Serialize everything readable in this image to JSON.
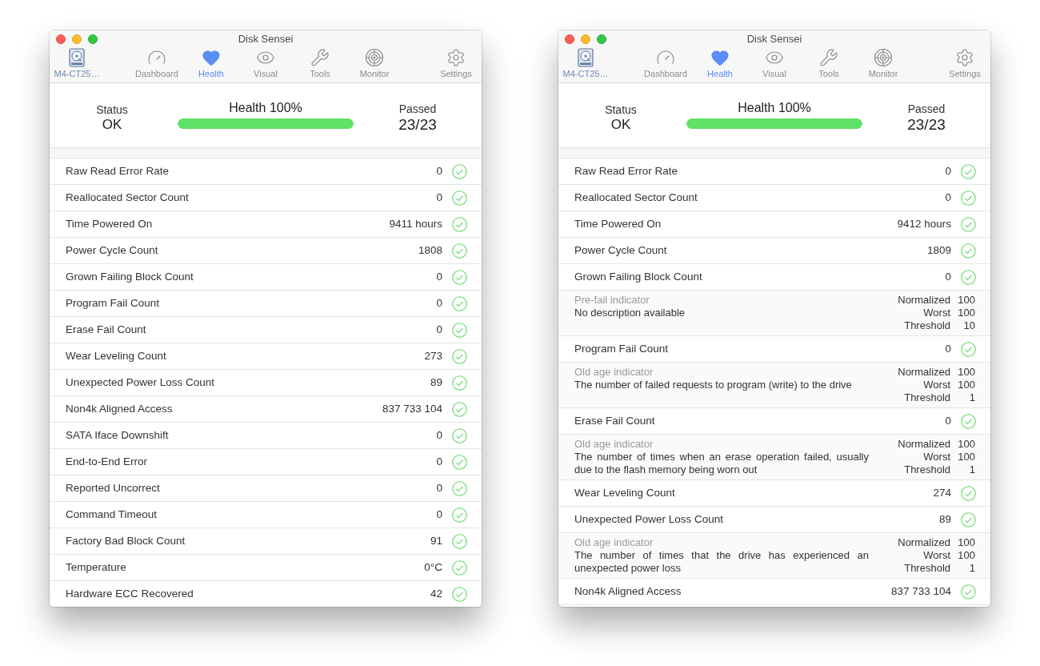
{
  "windows": [
    {
      "title": "Disk Sensei",
      "drive": {
        "label": "M4-CT25…"
      },
      "tabs": [
        {
          "label": "Dashboard",
          "selected": false
        },
        {
          "label": "Health",
          "selected": true
        },
        {
          "label": "Visual",
          "selected": false
        },
        {
          "label": "Tools",
          "selected": false
        },
        {
          "label": "Monitor",
          "selected": false
        }
      ],
      "settings": {
        "label": "Settings"
      },
      "summary": {
        "status_label": "Status",
        "status": "OK",
        "health_label": "Health 100%",
        "health_bar": {
          "level": 1
        },
        "passed_label": "Passed",
        "passed": "23/23"
      },
      "rows": [
        {
          "kind": "attribute",
          "name": "Raw Read Error Rate",
          "value": "0",
          "passed": true
        },
        {
          "kind": "attribute",
          "name": "Reallocated Sector Count",
          "value": "0",
          "passed": true
        },
        {
          "kind": "attribute",
          "name": "Time Powered On",
          "value": "9411 hours",
          "passed": true
        },
        {
          "kind": "attribute",
          "name": "Power Cycle Count",
          "value": "1808",
          "passed": true
        },
        {
          "kind": "attribute",
          "name": "Grown Failing Block Count",
          "value": "0",
          "passed": true
        },
        {
          "kind": "attribute",
          "name": "Program Fail Count",
          "value": "0",
          "passed": true
        },
        {
          "kind": "attribute",
          "name": "Erase Fail Count",
          "value": "0",
          "passed": true
        },
        {
          "kind": "attribute",
          "name": "Wear Leveling Count",
          "value": "273",
          "passed": true
        },
        {
          "kind": "attribute",
          "name": "Unexpected Power Loss Count",
          "value": "89",
          "passed": true
        },
        {
          "kind": "attribute",
          "name": "Non4k Aligned Access",
          "value": "837 733 104",
          "passed": true
        },
        {
          "kind": "attribute",
          "name": "SATA Iface Downshift",
          "value": "0",
          "passed": true
        },
        {
          "kind": "attribute",
          "name": "End-to-End Error",
          "value": "0",
          "passed": true
        },
        {
          "kind": "attribute",
          "name": "Reported Uncorrect",
          "value": "0",
          "passed": true
        },
        {
          "kind": "attribute",
          "name": "Command Timeout",
          "value": "0",
          "passed": true
        },
        {
          "kind": "attribute",
          "name": "Factory Bad Block Count",
          "value": "91",
          "passed": true
        },
        {
          "kind": "attribute",
          "name": "Temperature",
          "value": "0°C",
          "passed": true
        },
        {
          "kind": "attribute",
          "name": "Hardware ECC Recovered",
          "value": "42",
          "passed": true
        }
      ]
    },
    {
      "title": "Disk Sensei",
      "drive": {
        "label": "M4-CT25…"
      },
      "tabs": [
        {
          "label": "Dashboard",
          "selected": false
        },
        {
          "label": "Health",
          "selected": true
        },
        {
          "label": "Visual",
          "selected": false
        },
        {
          "label": "Tools",
          "selected": false
        },
        {
          "label": "Monitor",
          "selected": false
        }
      ],
      "settings": {
        "label": "Settings"
      },
      "summary": {
        "status_label": "Status",
        "status": "OK",
        "health_label": "Health 100%",
        "health_bar": {
          "level": 1
        },
        "passed_label": "Passed",
        "passed": "23/23"
      },
      "rows": [
        {
          "kind": "attribute",
          "name": "Raw Read Error Rate",
          "value": "0",
          "passed": true
        },
        {
          "kind": "attribute",
          "name": "Reallocated Sector Count",
          "value": "0",
          "passed": true
        },
        {
          "kind": "attribute",
          "name": "Time Powered On",
          "value": "9412 hours",
          "passed": true
        },
        {
          "kind": "attribute",
          "name": "Power Cycle Count",
          "value": "1809",
          "passed": true
        },
        {
          "kind": "attribute",
          "name": "Grown Failing Block Count",
          "value": "0",
          "passed": true
        },
        {
          "kind": "detail",
          "indicator": "Pre-fail indicator",
          "description": "No description available",
          "stats": [
            {
              "label": "Normalized",
              "value": "100"
            },
            {
              "label": "Worst",
              "value": "100"
            },
            {
              "label": "Threshold",
              "value": "10"
            }
          ]
        },
        {
          "kind": "attribute",
          "name": "Program Fail Count",
          "value": "0",
          "passed": true
        },
        {
          "kind": "detail",
          "indicator": "Old age indicator",
          "description": "The number of failed requests to program (write) to the drive",
          "stats": [
            {
              "label": "Normalized",
              "value": "100"
            },
            {
              "label": "Worst",
              "value": "100"
            },
            {
              "label": "Threshold",
              "value": "1"
            }
          ]
        },
        {
          "kind": "attribute",
          "name": "Erase Fail Count",
          "value": "0",
          "passed": true
        },
        {
          "kind": "detail",
          "indicator": "Old age indicator",
          "description": "The number of times when an erase operation failed, usually due to the flash memory being worn out",
          "stats": [
            {
              "label": "Normalized",
              "value": "100"
            },
            {
              "label": "Worst",
              "value": "100"
            },
            {
              "label": "Threshold",
              "value": "1"
            }
          ]
        },
        {
          "kind": "attribute",
          "name": "Wear Leveling Count",
          "value": "274",
          "passed": true
        },
        {
          "kind": "attribute",
          "name": "Unexpected Power Loss Count",
          "value": "89",
          "passed": true
        },
        {
          "kind": "detail",
          "indicator": "Old age indicator",
          "description": "The number of times that the drive has experienced an unexpected power loss",
          "stats": [
            {
              "label": "Normalized",
              "value": "100"
            },
            {
              "label": "Worst",
              "value": "100"
            },
            {
              "label": "Threshold",
              "value": "1"
            }
          ]
        },
        {
          "kind": "attribute",
          "name": "Non4k Aligned Access",
          "value": "837 733 104",
          "passed": true
        }
      ]
    }
  ]
}
